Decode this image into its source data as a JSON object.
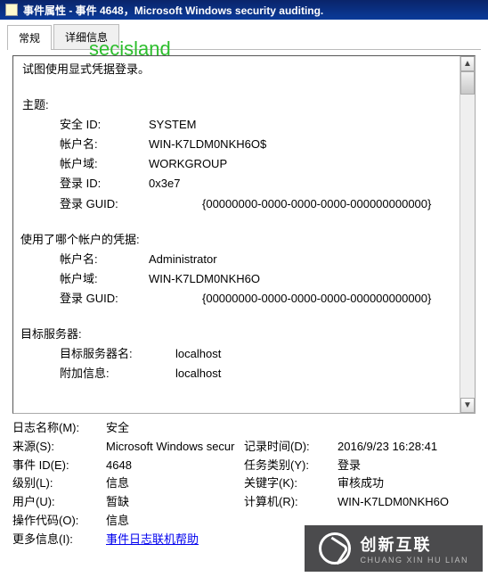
{
  "window": {
    "title": "事件属性 - 事件 4648，Microsoft Windows security auditing."
  },
  "tabs": {
    "general": "常规",
    "details": "详细信息"
  },
  "watermark": "secisland",
  "pane": {
    "intro": "试图使用显式凭据登录。",
    "subject": {
      "heading": "主题:",
      "securityId_lbl": "安全 ID:",
      "securityId_val": "SYSTEM",
      "accountName_lbl": "帐户名:",
      "accountName_val": "WIN-K7LDM0NKH6O$",
      "accountDomain_lbl": "帐户域:",
      "accountDomain_val": "WORKGROUP",
      "logonId_lbl": "登录 ID:",
      "logonId_val": "0x3e7",
      "logonGuid_lbl": "登录 GUID:",
      "logonGuid_val": "{00000000-0000-0000-0000-000000000000}"
    },
    "usedAccount": {
      "heading": "使用了哪个帐户的凭据:",
      "accountName_lbl": "帐户名:",
      "accountName_val": "Administrator",
      "accountDomain_lbl": "帐户域:",
      "accountDomain_val": "WIN-K7LDM0NKH6O",
      "logonGuid_lbl": "登录 GUID:",
      "logonGuid_val": "{00000000-0000-0000-0000-000000000000}"
    },
    "targetServer": {
      "heading": "目标服务器:",
      "serverName_lbl": "目标服务器名:",
      "serverName_val": "localhost",
      "addInfo_lbl": "附加信息:",
      "addInfo_val": "localhost"
    }
  },
  "meta": {
    "logName_lbl": "日志名称(M):",
    "logName_val": "安全",
    "source_lbl": "来源(S):",
    "source_val": "Microsoft Windows secur",
    "logged_lbl": "记录时间(D):",
    "logged_val": "2016/9/23 16:28:41",
    "eventId_lbl": "事件 ID(E):",
    "eventId_val": "4648",
    "taskCat_lbl": "任务类别(Y):",
    "taskCat_val": "登录",
    "level_lbl": "级别(L):",
    "level_val": "信息",
    "keywords_lbl": "关键字(K):",
    "keywords_val": "审核成功",
    "user_lbl": "用户(U):",
    "user_val": "暂缺",
    "computer_lbl": "计算机(R):",
    "computer_val": "WIN-K7LDM0NKH6O",
    "opcode_lbl": "操作代码(O):",
    "opcode_val": "信息",
    "moreInfo_lbl": "更多信息(I):",
    "moreInfo_link": "事件日志联机帮助"
  },
  "logo": {
    "top": "创新互联",
    "sub": "CHUANG XIN HU LIAN"
  }
}
